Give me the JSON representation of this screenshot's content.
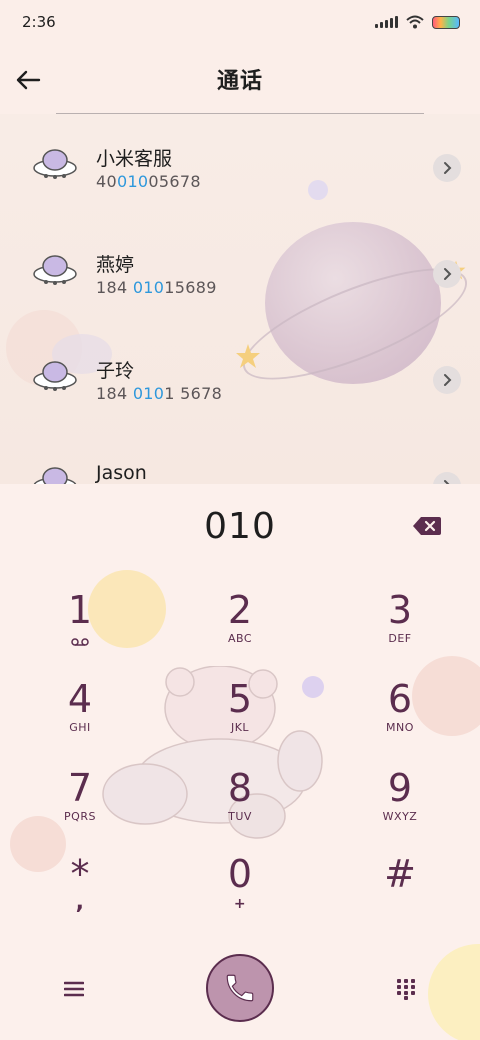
{
  "status_bar": {
    "time": "2:36"
  },
  "header": {
    "title": "通话"
  },
  "contacts": [
    {
      "name": "小米客服",
      "number_parts": [
        "40",
        "010",
        "05678"
      ]
    },
    {
      "name": "燕婷",
      "number_parts": [
        "184 ",
        "010",
        "15689"
      ]
    },
    {
      "name": "子玲",
      "number_parts": [
        "184 ",
        "010",
        "1 5678"
      ]
    },
    {
      "name": "Jason",
      "number_parts": [
        "",
        "",
        ""
      ]
    }
  ],
  "dialer": {
    "input_value": "010",
    "keys": [
      {
        "digit": "1",
        "letters": ""
      },
      {
        "digit": "2",
        "letters": "ABC"
      },
      {
        "digit": "3",
        "letters": "DEF"
      },
      {
        "digit": "4",
        "letters": "GHI"
      },
      {
        "digit": "5",
        "letters": "JKL"
      },
      {
        "digit": "6",
        "letters": "MNO"
      },
      {
        "digit": "7",
        "letters": "PQRS"
      },
      {
        "digit": "8",
        "letters": "TUV"
      },
      {
        "digit": "9",
        "letters": "WXYZ"
      },
      {
        "digit": "*",
        "letters": ","
      },
      {
        "digit": "0",
        "letters": "+"
      },
      {
        "digit": "#",
        "letters": ""
      }
    ]
  },
  "icons": {
    "back": "back-arrow-icon",
    "backspace": "backspace-icon",
    "voicemail": "voicemail-icon",
    "menu": "menu-icon",
    "call": "phone-icon",
    "keypad": "keypad-icon",
    "detail": "chevron-right-icon"
  },
  "colors": {
    "highlight": "#2e98dc",
    "key_text": "#5b2d4e",
    "call_button": "#bd94ad",
    "background": "#fbeee9"
  }
}
